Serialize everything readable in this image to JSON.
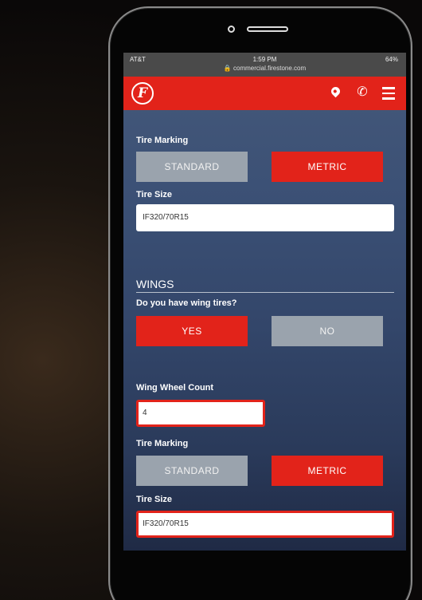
{
  "status_bar": {
    "carrier": "AT&T",
    "time": "1:59 PM",
    "battery": "64%",
    "url": "commercial.firestone.com"
  },
  "navbar": {
    "logo_letter": "F",
    "icons": [
      "location-pin-icon",
      "phone-icon",
      "menu-icon"
    ],
    "brand_color": "#e2231a"
  },
  "form": {
    "tire_marking_1": {
      "label": "Tire Marking",
      "options": [
        "STANDARD",
        "METRIC"
      ],
      "selected": "METRIC"
    },
    "tire_size_1": {
      "label": "Tire Size",
      "value": "IF320/70R15"
    },
    "wings": {
      "section_title": "WINGS",
      "question": "Do you have wing tires?",
      "options": [
        "YES",
        "NO"
      ],
      "selected": "YES"
    },
    "wing_wheel_count": {
      "label": "Wing Wheel Count",
      "value": "4"
    },
    "tire_marking_2": {
      "label": "Tire Marking",
      "options": [
        "STANDARD",
        "METRIC"
      ],
      "selected": "METRIC"
    },
    "tire_size_2": {
      "label": "Tire Size",
      "value": "IF320/70R15"
    }
  }
}
